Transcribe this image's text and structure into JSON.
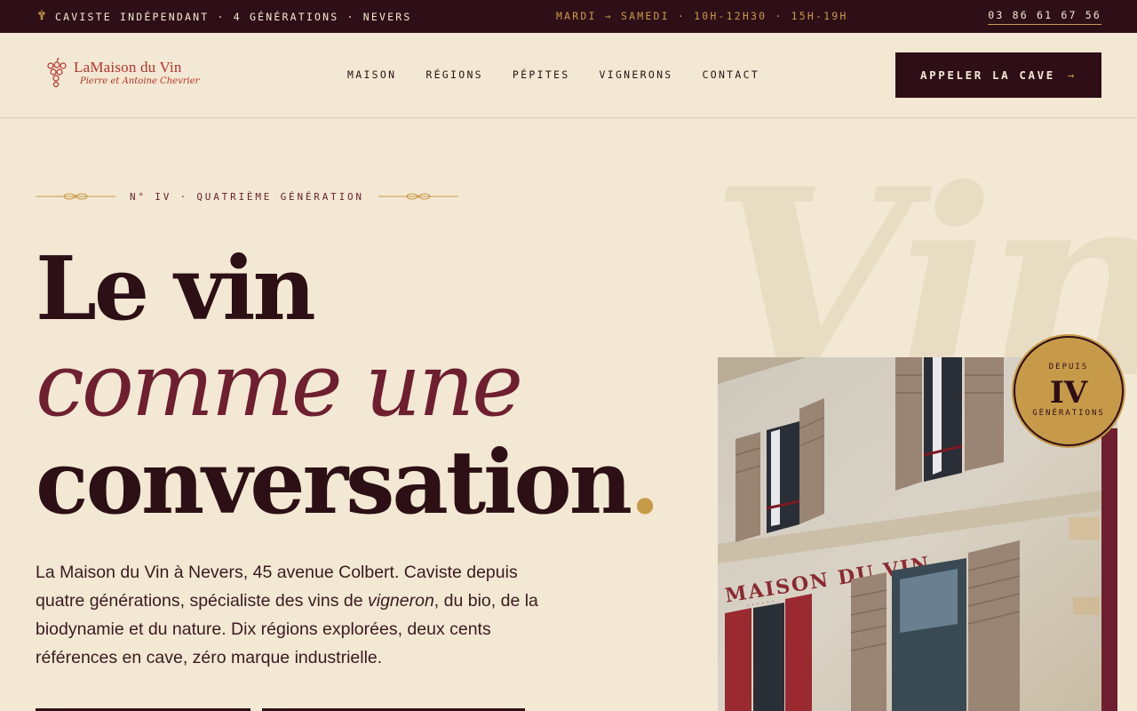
{
  "topbar": {
    "tagline": "CAVISTE INDÉPENDANT · 4 GÉNÉRATIONS · NEVERS",
    "hours": "MARDI → SAMEDI · 10H-12H30 · 15H-19H",
    "phone": "03 86 61 67 56"
  },
  "header": {
    "logo_name": "LaMaison du Vin",
    "logo_sub": "Pierre et Antoine Chevrier",
    "nav": [
      "MAISON",
      "RÉGIONS",
      "PÉPITES",
      "VIGNERONS",
      "CONTACT"
    ],
    "cta_label": "APPELER LA CAVE",
    "cta_arrow": "→"
  },
  "hero": {
    "eyebrow": "N° IV · QUATRIÈME GÉNÉRATION",
    "line1": "Le vin",
    "line2": "comme une",
    "line3": "conversation",
    "line3_dot": ".",
    "lead_part1": "La Maison du Vin à Nevers, 45 avenue Colbert. Caviste depuis quatre générations, spécialiste des vins de ",
    "lead_em": "vigneron",
    "lead_part2": ", du bio, de la biodynamie et du nature. Dix régions explorées, deux cents références en cave, zéro marque industrielle.",
    "watermark": "Vin",
    "photo_sign": "MAISON DU VIN"
  },
  "badge": {
    "top": "DEPUIS",
    "numeral": "IV",
    "bottom": "GÉNÉRATIONS"
  },
  "colors": {
    "bordeaux_dark": "#2e0f17",
    "gold": "#c79a4a",
    "cream": "#f3e8d3",
    "wine": "#6e1f30",
    "logo_red": "#b7332e"
  }
}
